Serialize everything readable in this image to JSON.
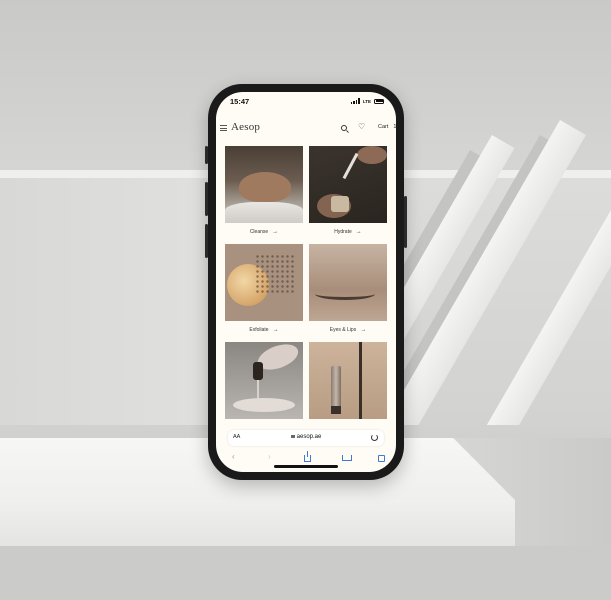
{
  "status_bar": {
    "time": "15:47",
    "network": "LTE"
  },
  "header": {
    "brand": "Aesop",
    "cart_label": "Cart",
    "cart_count": "1",
    "icons": [
      "menu-icon",
      "search-icon",
      "heart-icon"
    ]
  },
  "categories": [
    {
      "label": "Cleanse",
      "arrow": "→"
    },
    {
      "label": "Hydrate",
      "arrow": "→"
    },
    {
      "label": "Exfoliate",
      "arrow": "→"
    },
    {
      "label": "Eyes & Lips",
      "arrow": "→"
    }
  ],
  "browser": {
    "text_size": "AA",
    "url": "aesop.ae",
    "nav": {
      "back": "‹",
      "forward": "›"
    }
  },
  "colors": {
    "screen_background": "#fefcf4",
    "link_blue": "#3a7bd5",
    "phone_frame": "#1a1a1a"
  }
}
